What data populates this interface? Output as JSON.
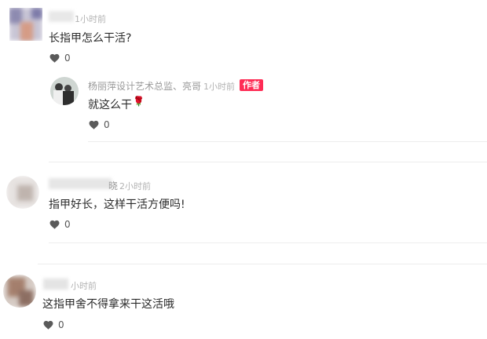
{
  "comments": [
    {
      "time": "1小时前",
      "text": "长指甲怎么干活?",
      "likes": "0",
      "reply": {
        "author": "杨丽萍设计艺术总监、亮哥",
        "time": "1小时前",
        "badge": "作者",
        "text": "就这么干",
        "emoji": "🌹",
        "likes": "0"
      }
    },
    {
      "author_tail": "晓",
      "time": "2小时前",
      "text": "指甲好长，这样干活方便吗!",
      "likes": "0"
    },
    {
      "time": "小时前",
      "text": "这指甲舍不得拿来干这活哦",
      "likes": "0"
    }
  ],
  "colors": {
    "badge": "#fe2c55",
    "meta": "#b3b3b3",
    "divider": "#ededed"
  },
  "icons": {
    "like": "heart-icon"
  }
}
